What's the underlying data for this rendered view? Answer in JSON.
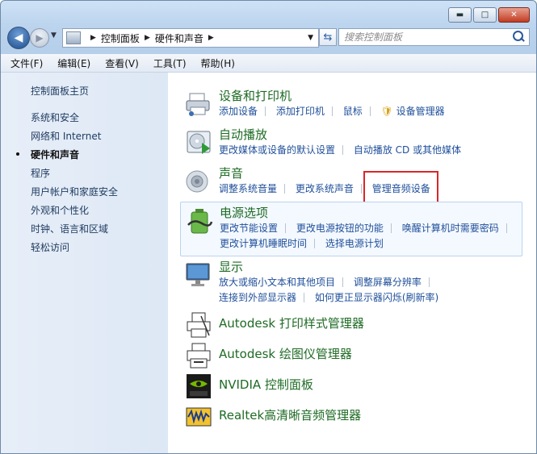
{
  "window": {
    "minimize": "▬",
    "maximize": "□",
    "close": "✕"
  },
  "address": {
    "crumbs": [
      "控制面板",
      "硬件和声音"
    ],
    "search_placeholder": "搜索控制面板"
  },
  "menu": [
    "文件(F)",
    "编辑(E)",
    "查看(V)",
    "工具(T)",
    "帮助(H)"
  ],
  "sidebar": {
    "items": [
      "控制面板主页",
      "系统和安全",
      "网络和 Internet",
      "硬件和声音",
      "程序",
      "用户帐户和家庭安全",
      "外观和个性化",
      "时钟、语言和区域",
      "轻松访问"
    ],
    "active_index": 3
  },
  "categories": [
    {
      "title": "设备和打印机",
      "icon": "printer-icon",
      "links": [
        "添加设备",
        "添加打印机",
        "鼠标",
        "设备管理器"
      ]
    },
    {
      "title": "自动播放",
      "icon": "autoplay-icon",
      "links": [
        "更改媒体或设备的默认设置",
        "自动播放 CD 或其他媒体"
      ]
    },
    {
      "title": "声音",
      "icon": "speaker-icon",
      "links": [
        "调整系统音量",
        "更改系统声音",
        "管理音频设备"
      ]
    },
    {
      "title": "电源选项",
      "icon": "power-icon",
      "links": [
        "更改节能设置",
        "更改电源按钮的功能",
        "唤醒计算机时需要密码"
      ],
      "links2": [
        "更改计算机睡眠时间",
        "选择电源计划"
      ]
    },
    {
      "title": "显示",
      "icon": "monitor-icon",
      "links": [
        "放大或缩小文本和其他项目",
        "调整屏幕分辨率"
      ],
      "links2": [
        "连接到外部显示器",
        "如何更正显示器闪烁(刷新率)"
      ]
    }
  ],
  "extra_items": [
    {
      "title": "Autodesk 打印样式管理器",
      "icon": "autodesk-plot-style-icon"
    },
    {
      "title": "Autodesk 绘图仪管理器",
      "icon": "autodesk-plotter-icon"
    },
    {
      "title": "NVIDIA 控制面板",
      "icon": "nvidia-icon"
    },
    {
      "title": "Realtek高清晰音频管理器",
      "icon": "realtek-audio-icon"
    }
  ],
  "colors": {
    "category_title": "#1e6b24",
    "link": "#1f4f9a",
    "highlight": "#d9262c"
  }
}
